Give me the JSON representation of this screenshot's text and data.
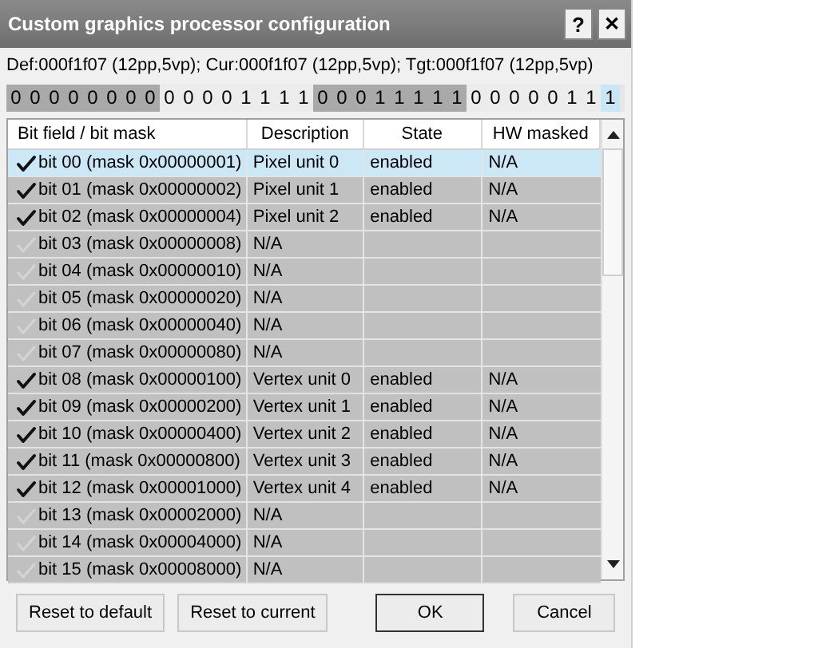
{
  "window": {
    "title": "Custom graphics processor configuration",
    "help": "?",
    "close": "✕"
  },
  "info": "Def:000f1f07 (12pp,5vp); Cur:000f1f07 (12pp,5vp); Tgt:000f1f07 (12pp,5vp)",
  "bits": [
    {
      "text": "0",
      "selected": false
    },
    {
      "text": "0",
      "selected": false
    },
    {
      "text": "0",
      "selected": false
    },
    {
      "text": "0",
      "selected": false
    },
    {
      "text": "0",
      "selected": false
    },
    {
      "text": "0",
      "selected": false
    },
    {
      "text": "0",
      "selected": false
    },
    {
      "text": "0",
      "selected": false
    },
    {
      "text": "0",
      "selected": false
    },
    {
      "text": "0",
      "selected": false
    },
    {
      "text": "0",
      "selected": false
    },
    {
      "text": "0",
      "selected": false
    },
    {
      "text": "1",
      "selected": false
    },
    {
      "text": "1",
      "selected": false
    },
    {
      "text": "1",
      "selected": false
    },
    {
      "text": "1",
      "selected": false
    },
    {
      "text": "0",
      "selected": false
    },
    {
      "text": "0",
      "selected": false
    },
    {
      "text": "0",
      "selected": false
    },
    {
      "text": "1",
      "selected": false
    },
    {
      "text": "1",
      "selected": false
    },
    {
      "text": "1",
      "selected": false
    },
    {
      "text": "1",
      "selected": false
    },
    {
      "text": "1",
      "selected": false
    },
    {
      "text": "0",
      "selected": false
    },
    {
      "text": "0",
      "selected": false
    },
    {
      "text": "0",
      "selected": false
    },
    {
      "text": "0",
      "selected": false
    },
    {
      "text": "0",
      "selected": false
    },
    {
      "text": "1",
      "selected": false
    },
    {
      "text": "1",
      "selected": false
    },
    {
      "text": "1",
      "selected": true
    }
  ],
  "table": {
    "columns": [
      "Bit field / bit mask",
      "Description",
      "State",
      "HW masked"
    ],
    "rows": [
      {
        "bit": "bit 00 (mask 0x00000001)",
        "description": "Pixel unit 0",
        "state": "enabled",
        "hw_masked": "N/A",
        "checked": true,
        "selected": true
      },
      {
        "bit": "bit 01 (mask 0x00000002)",
        "description": "Pixel unit 1",
        "state": "enabled",
        "hw_masked": "N/A",
        "checked": true,
        "selected": false
      },
      {
        "bit": "bit 02 (mask 0x00000004)",
        "description": "Pixel unit 2",
        "state": "enabled",
        "hw_masked": "N/A",
        "checked": true,
        "selected": false
      },
      {
        "bit": "bit 03 (mask 0x00000008)",
        "description": "N/A",
        "checked": false,
        "selected": false
      },
      {
        "bit": "bit 04 (mask 0x00000010)",
        "description": "N/A",
        "checked": false,
        "selected": false
      },
      {
        "bit": "bit 05 (mask 0x00000020)",
        "description": "N/A",
        "checked": false,
        "selected": false
      },
      {
        "bit": "bit 06 (mask 0x00000040)",
        "description": "N/A",
        "checked": false,
        "selected": false
      },
      {
        "bit": "bit 07 (mask 0x00000080)",
        "description": "N/A",
        "checked": false,
        "selected": false
      },
      {
        "bit": "bit 08 (mask 0x00000100)",
        "description": "Vertex unit 0",
        "state": "enabled",
        "hw_masked": "N/A",
        "checked": true,
        "selected": false
      },
      {
        "bit": "bit 09 (mask 0x00000200)",
        "description": "Vertex unit 1",
        "state": "enabled",
        "hw_masked": "N/A",
        "checked": true,
        "selected": false
      },
      {
        "bit": "bit 10 (mask 0x00000400)",
        "description": "Vertex unit 2",
        "state": "enabled",
        "hw_masked": "N/A",
        "checked": true,
        "selected": false
      },
      {
        "bit": "bit 11 (mask 0x00000800)",
        "description": "Vertex unit 3",
        "state": "enabled",
        "hw_masked": "N/A",
        "checked": true,
        "selected": false
      },
      {
        "bit": "bit 12 (mask 0x00001000)",
        "description": "Vertex unit 4",
        "state": "enabled",
        "hw_masked": "N/A",
        "checked": true,
        "selected": false
      },
      {
        "bit": "bit 13 (mask 0x00002000)",
        "description": "N/A",
        "checked": false,
        "selected": false
      },
      {
        "bit": "bit 14 (mask 0x00004000)",
        "description": "N/A",
        "checked": false,
        "selected": false
      },
      {
        "bit": "bit 15 (mask 0x00008000)",
        "description": "N/A",
        "checked": false,
        "selected": false
      }
    ]
  },
  "buttons": [
    {
      "label": "Reset to default",
      "default": false
    },
    {
      "label": "Reset to current",
      "default": false
    },
    {
      "label": "OK",
      "default": true
    },
    {
      "label": "Cancel",
      "default": false
    }
  ]
}
